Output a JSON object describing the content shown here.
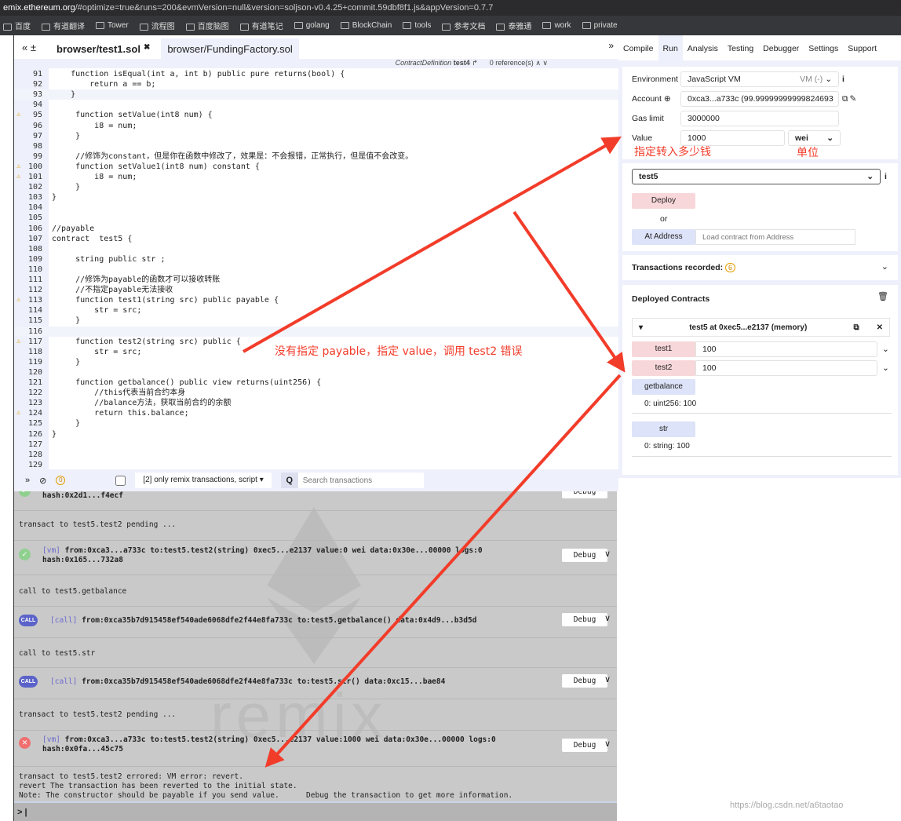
{
  "browser": {
    "url_host": "emix.ethereum.org",
    "url_rest": "/#optimize=true&runs=200&evmVersion=null&version=soljson-v0.4.25+commit.59dbf8f1.js&appVersion=0.7.7",
    "bookmarks": [
      "百度",
      "有道翻译",
      "Tower",
      "流程图",
      "百度脑图",
      "有道笔记",
      "golang",
      "BlockChain",
      "tools",
      "参考文档",
      "泰雅通",
      "work",
      "private"
    ]
  },
  "editor": {
    "tabs": [
      {
        "label": "browser/test1.sol",
        "active": true
      },
      {
        "label": "browser/FundingFactory.sol",
        "active": false
      }
    ],
    "context": {
      "kind": "ContractDefinition",
      "name": "test4",
      "refs": "0 reference(s)"
    },
    "lines": [
      {
        "n": 91,
        "t": "    function isEqual(int a, int b) public pure returns(bool) {"
      },
      {
        "n": 92,
        "t": "        return a == b;"
      },
      {
        "n": 93,
        "t": "    }",
        "hl": true
      },
      {
        "n": 94,
        "t": ""
      },
      {
        "n": 95,
        "t": "     function setValue(int8 num) {",
        "warn": true
      },
      {
        "n": 96,
        "t": "         i8 = num;"
      },
      {
        "n": 97,
        "t": "     }"
      },
      {
        "n": 98,
        "t": ""
      },
      {
        "n": 99,
        "t": "     //修饰为constant，但是你在函数中修改了，效果是：不会报错，正常执行，但是值不会改变。"
      },
      {
        "n": 100,
        "t": "     function setValue1(int8 num) constant {",
        "warn": true
      },
      {
        "n": 101,
        "t": "         i8 = num;",
        "warn": true
      },
      {
        "n": 102,
        "t": "     }"
      },
      {
        "n": 103,
        "t": "}"
      },
      {
        "n": 104,
        "t": ""
      },
      {
        "n": 105,
        "t": ""
      },
      {
        "n": 106,
        "t": "//payable"
      },
      {
        "n": 107,
        "t": "contract  test5 {"
      },
      {
        "n": 108,
        "t": ""
      },
      {
        "n": 109,
        "t": "     string public str ;"
      },
      {
        "n": 110,
        "t": ""
      },
      {
        "n": 111,
        "t": "     //修饰为payable的函数才可以接收转账"
      },
      {
        "n": 112,
        "t": "     //不指定payable无法接收"
      },
      {
        "n": 113,
        "t": "     function test1(string src) public payable {",
        "warn": true
      },
      {
        "n": 114,
        "t": "         str = src;"
      },
      {
        "n": 115,
        "t": "     }"
      },
      {
        "n": 116,
        "t": "",
        "hl": true
      },
      {
        "n": 117,
        "t": "     function test2(string src) public {",
        "warn": true
      },
      {
        "n": 118,
        "t": "         str = src;"
      },
      {
        "n": 119,
        "t": "     }"
      },
      {
        "n": 120,
        "t": ""
      },
      {
        "n": 121,
        "t": "     function getbalance() public view returns(uint256) {"
      },
      {
        "n": 122,
        "t": "         //this代表当前合约本身"
      },
      {
        "n": 123,
        "t": "         //balance方法，获取当前合约的余额"
      },
      {
        "n": 124,
        "t": "         return this.balance;",
        "warn": true
      },
      {
        "n": 125,
        "t": "     }"
      },
      {
        "n": 126,
        "t": "}"
      },
      {
        "n": 127,
        "t": ""
      },
      {
        "n": 128,
        "t": ""
      },
      {
        "n": 129,
        "t": ""
      }
    ]
  },
  "terminal": {
    "pending_count": "0",
    "filter": "[2] only remix transactions, script",
    "search_placeholder": "Search transactions",
    "debug_label": "Debug",
    "watermark": "remix",
    "entries": {
      "e0_hash": "hash:0x2d1...f4ecf",
      "m1": "transact to test5.test2 pending ...",
      "e2_tag": "[vm]",
      "e2_line1": "from:0xca3...a733c to:test5.test2(string) 0xec5...e2137 value:0 wei data:0x30e...00000 logs:0",
      "e2_line2": "hash:0x165...732a8",
      "m3": "call to test5.getbalance",
      "e4_tag": "[call]",
      "e4_line1": "from:0xca35b7d915458ef540ade6068dfe2f44e8fa733c to:test5.getbalance() data:0x4d9...b3d5d",
      "m5": "call to test5.str",
      "e6_tag": "[call]",
      "e6_line1": "from:0xca35b7d915458ef540ade6068dfe2f44e8fa733c to:test5.str() data:0xc15...bae84",
      "m7": "transact to test5.test2 pending ...",
      "e8_tag": "[vm]",
      "e8_line1": "from:0xca3...a733c to:test5.test2(string) 0xec5...e2137 value:1000 wei data:0x30e...00000 logs:0",
      "e8_line2": "hash:0x0fa...45c75",
      "err1": "transact to test5.test2 errored: VM error: revert.",
      "err2": "revert  The transaction has been reverted to the initial state.",
      "err3": "Note: The constructor should be payable if you send value.      Debug the transaction to get more information."
    },
    "prompt": ">"
  },
  "right": {
    "tabs": [
      "Compile",
      "Run",
      "Analysis",
      "Testing",
      "Debugger",
      "Settings",
      "Support"
    ],
    "active_tab": "Run",
    "environment_label": "Environment",
    "environment_value": "JavaScript VM",
    "environment_badge": "VM (-)",
    "account_label": "Account",
    "account_value": "0xca3...a733c (99.99999999999824693",
    "gas_label": "Gas limit",
    "gas_value": "3000000",
    "value_label": "Value",
    "value_value": "1000",
    "value_unit": "wei",
    "contract_select": "test5",
    "deploy_label": "Deploy",
    "or_label": "or",
    "at_address_label": "At Address",
    "at_address_placeholder": "Load contract from Address",
    "tx_recorded_label": "Transactions recorded:",
    "tx_recorded_count": "6",
    "deployed_label": "Deployed Contracts",
    "instance_title": "test5 at 0xec5...e2137 (memory)",
    "functions": [
      {
        "name": "test1",
        "value": "100"
      },
      {
        "name": "test2",
        "value": "100"
      }
    ],
    "getbalance_label": "getbalance",
    "getbalance_result": "0: uint256: 100",
    "str_label": "str",
    "str_result": "0: string: 100"
  },
  "annotations": {
    "value_note": "指定转入多少钱",
    "unit_note": "单位",
    "error_note": "没有指定 payable，指定 value，调用 test2 错误",
    "color": "#f23c2a"
  },
  "blog_watermark": "https://blog.csdn.net/a6taotao"
}
